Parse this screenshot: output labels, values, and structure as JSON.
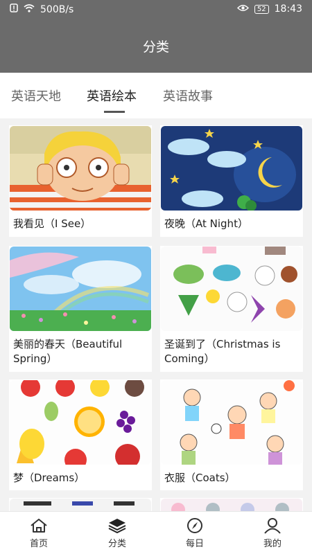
{
  "status": {
    "speed": "500B/s",
    "battery": "52",
    "time": "18:43"
  },
  "header": {
    "title": "分类"
  },
  "tabs": [
    {
      "label": "英语天地"
    },
    {
      "label": "英语绘本"
    },
    {
      "label": "英语故事"
    }
  ],
  "cards": [
    {
      "title": "我看见（I See）"
    },
    {
      "title": "夜晚（At Night）"
    },
    {
      "title": "美丽的春天（Beautiful Spring）"
    },
    {
      "title": "圣诞到了（Christmas is Coming）"
    },
    {
      "title": "梦（Dreams）"
    },
    {
      "title": "衣服（Coats）"
    }
  ],
  "bottom_nav": [
    {
      "label": "首页",
      "icon": "home-icon"
    },
    {
      "label": "分类",
      "icon": "layers-icon"
    },
    {
      "label": "每日",
      "icon": "compass-icon"
    },
    {
      "label": "我的",
      "icon": "user-icon"
    }
  ],
  "colors": {
    "header_bg": "#6b6b6b",
    "page_bg": "#f2f2f2"
  }
}
